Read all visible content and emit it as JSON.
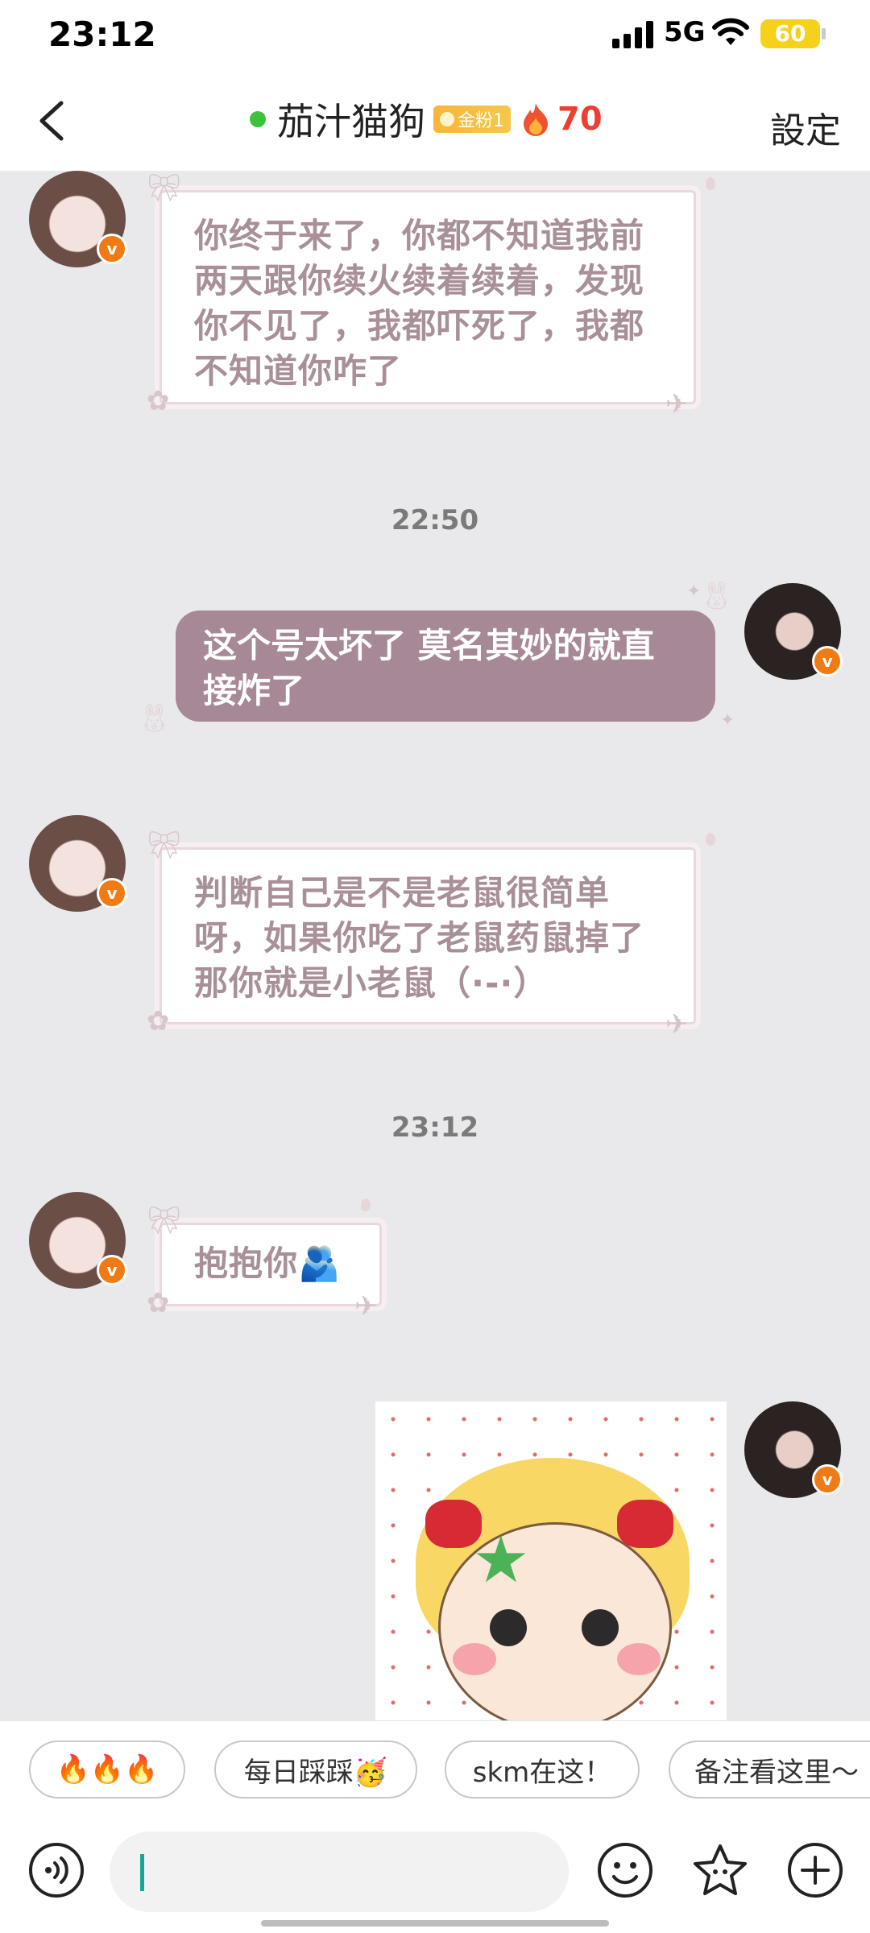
{
  "status_bar": {
    "time": "23:12",
    "network": "5G",
    "battery": "60"
  },
  "header": {
    "contact_name": "茄汁猫狗",
    "fan_badge": "金粉1",
    "fire_count": "70",
    "settings_label": "設定",
    "online_color": "#3cc23c"
  },
  "messages": [
    {
      "from": "other",
      "text": "你终于来了，你都不知道我前两天跟你续火续着续着，发现你不见了，我都吓死了，我都不知道你咋了"
    },
    {
      "type": "timestamp",
      "text": "22:50"
    },
    {
      "from": "me",
      "text": "这个号太坏了 莫名其妙的就直接炸了"
    },
    {
      "from": "other",
      "text": "判断自己是不是老鼠很简单呀，如果你吃了老鼠药鼠掉了那你就是小老鼠（·-·）"
    },
    {
      "type": "timestamp",
      "text": "23:12"
    },
    {
      "from": "other",
      "text": "抱抱你🫂"
    },
    {
      "from": "me",
      "type": "sticker",
      "icon": "crying-girl-sticker"
    }
  ],
  "avatar_badge": "v",
  "quick_replies": [
    "🔥🔥🔥",
    "每日踩踩🥳",
    "skm在这！",
    "备注看这里～"
  ],
  "colors": {
    "my_bubble": "#a78896",
    "card_text": "#a88f98",
    "badge": "#f07a14",
    "fire": "#ee3e30"
  }
}
